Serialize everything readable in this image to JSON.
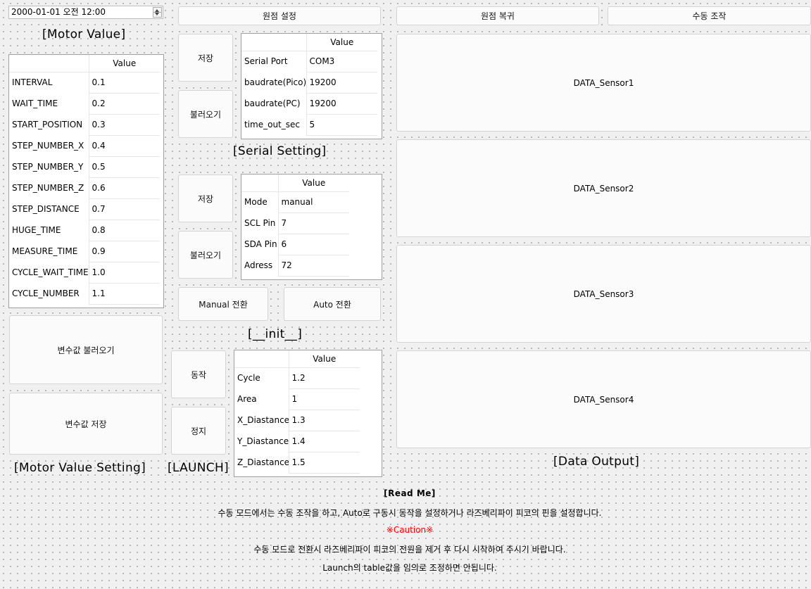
{
  "datetime": {
    "value": "2000-01-01 오전 12:00"
  },
  "motor": {
    "title": "[Motor Value]",
    "header": "Value",
    "rows": [
      {
        "name": "INTERVAL",
        "value": "0.1"
      },
      {
        "name": "WAIT_TIME",
        "value": "0.2"
      },
      {
        "name": "START_POSITION",
        "value": "0.3"
      },
      {
        "name": "STEP_NUMBER_X",
        "value": "0.4"
      },
      {
        "name": "STEP_NUMBER_Y",
        "value": "0.5"
      },
      {
        "name": "STEP_NUMBER_Z",
        "value": "0.6"
      },
      {
        "name": "STEP_DISTANCE",
        "value": "0.7"
      },
      {
        "name": "HUGE_TIME",
        "value": "0.8"
      },
      {
        "name": "MEASURE_TIME",
        "value": "0.9"
      },
      {
        "name": "CYCLE_WAIT_TIME",
        "value": "1.0"
      },
      {
        "name": "CYCLE_NUMBER",
        "value": "1.1"
      }
    ],
    "load_label": "변수값 불러오기",
    "save_label": "변수값 저장",
    "setting_title": "[Motor Value Setting]"
  },
  "toolbar": {
    "origin_set": "원점 설정",
    "origin_return": "원점 복귀",
    "manual_control": "수동 조작"
  },
  "serial": {
    "title": "[Serial Setting]",
    "header": "Value",
    "save_label": "저장",
    "load_label": "불러오기",
    "rows": [
      {
        "name": "Serial Port",
        "value": "COM3"
      },
      {
        "name": "baudrate(Pico)",
        "value": "19200"
      },
      {
        "name": "baudrate(PC)",
        "value": "19200"
      },
      {
        "name": "time_out_sec",
        "value": "5"
      }
    ]
  },
  "init": {
    "title": "[__init__]",
    "header": "Value",
    "save_label": "저장",
    "load_label": "불러오기",
    "rows": [
      {
        "name": "Mode",
        "value": "manual"
      },
      {
        "name": "SCL Pin",
        "value": "7"
      },
      {
        "name": "SDA Pin",
        "value": "6"
      },
      {
        "name": "Adress",
        "value": "72"
      }
    ],
    "manual_btn": "Manual 전환",
    "auto_btn": "Auto 전환"
  },
  "launch": {
    "title": "[LAUNCH]",
    "header": "Value",
    "run_label": "동작",
    "stop_label": "정지",
    "rows": [
      {
        "name": "Cycle",
        "value": "1.2"
      },
      {
        "name": "Area",
        "value": "1"
      },
      {
        "name": "X_Diastance",
        "value": "1.3"
      },
      {
        "name": "Y_Diastance",
        "value": "1.4"
      },
      {
        "name": "Z_Diastance",
        "value": "1.5"
      }
    ]
  },
  "data_output": {
    "title": "[Data Output]",
    "sensors": [
      "DATA_Sensor1",
      "DATA_Sensor2",
      "DATA_Sensor3",
      "DATA_Sensor4"
    ]
  },
  "readme": {
    "title": "[Read Me]",
    "line1": "수동 모드에서는 수동 조작을 하고, Auto로 구동시 동작을 설정하거나 라즈베리파이 피코의 핀을 설정합니다.",
    "caution": "※Caution※",
    "line2": "수동 모드로 전환시 라즈베리파이 피코의 전원을 제거 후 다시 시작하여 주시기 바랍니다.",
    "line3": "Launch의 table값을 임의로 조정하면 안됩니다.",
    "caution_color": "#ff0000"
  }
}
